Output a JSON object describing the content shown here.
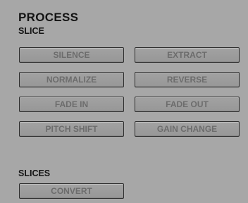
{
  "panel": {
    "title": "PROCESS",
    "slice_section": {
      "label": "SLICE",
      "buttons": [
        "SILENCE",
        "EXTRACT",
        "NORMALIZE",
        "REVERSE",
        "FADE IN",
        "FADE OUT",
        "PITCH SHIFT",
        "GAIN CHANGE"
      ]
    },
    "slices_section": {
      "label": "SLICES",
      "buttons": [
        "CONVERT"
      ]
    }
  },
  "colors": {
    "background": "#a7a7a7",
    "button_face": "#9d9d9d",
    "button_border": "#2e2e2e",
    "button_text": "#6c6c6c",
    "heading_text": "#141414"
  }
}
